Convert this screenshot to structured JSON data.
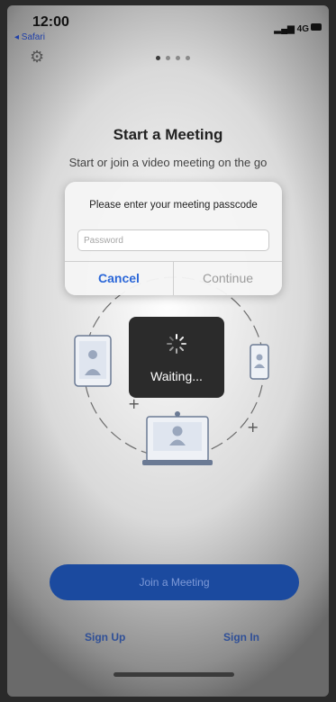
{
  "status": {
    "time": "12:00",
    "back_label": "◂ Safari",
    "network": "4G"
  },
  "header": {
    "title": "Start a Meeting",
    "subtitle": "Start or join a video meeting on the go"
  },
  "dialog": {
    "message": "Please enter your meeting passcode",
    "password_placeholder": "Password",
    "password_value": "",
    "cancel_label": "Cancel",
    "continue_label": "Continue"
  },
  "overlay": {
    "waiting_label": "Waiting..."
  },
  "actions": {
    "join_label": "Join a Meeting",
    "signup_label": "Sign Up",
    "signin_label": "Sign In"
  },
  "colors": {
    "accent": "#2b67d8",
    "join_button": "#1b4a9f"
  },
  "icons": {
    "settings": "gear-icon",
    "spinner": "spinner-icon"
  }
}
